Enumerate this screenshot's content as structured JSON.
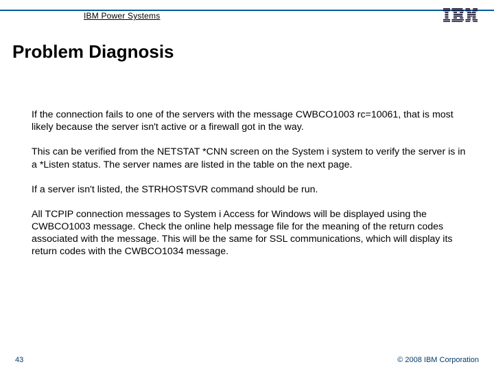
{
  "header": {
    "product_line": "IBM Power Systems",
    "logo_alt": "IBM"
  },
  "title": "Problem Diagnosis",
  "body": {
    "p1": "If the connection fails to one of the servers with the message CWBCO1003 rc=10061, that is most likely because the server isn't active or a firewall got in the way.",
    "p2": "This can be verified from the NETSTAT *CNN screen on the System i system to verify the server is in a *Listen status.  The server names are listed in the table on the next page.",
    "p3": "If a server isn't listed, the STRHOSTSVR command should be run.",
    "p4": "All TCPIP connection messages to System i Access for Windows will be displayed using the CWBCO1003 message.  Check the online help message file for the meaning of the return codes associated with the message.  This will be the same for SSL communications, which will display its return codes with the CWBCO1034 message."
  },
  "footer": {
    "page_number": "43",
    "copyright": "© 2008 IBM Corporation"
  }
}
